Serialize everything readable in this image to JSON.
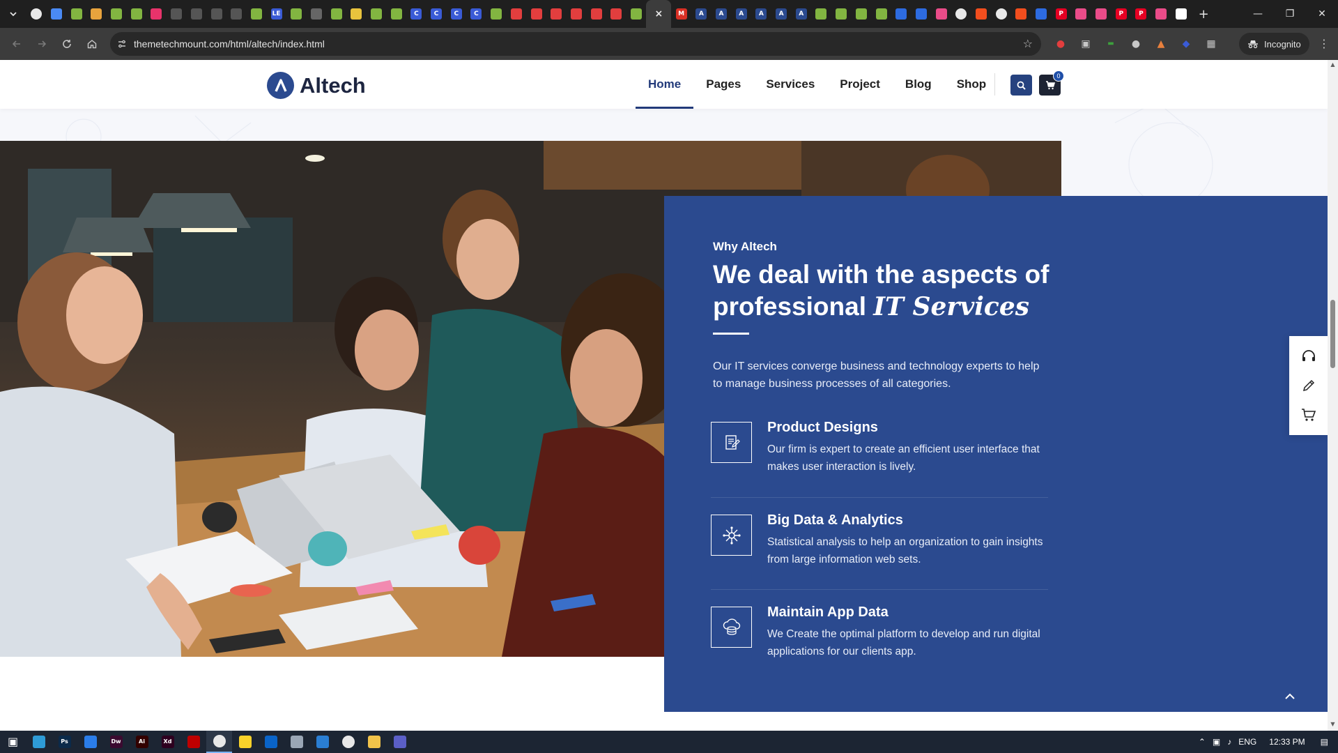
{
  "browser": {
    "tab_favicons": [
      {
        "icon": "chrome-icon",
        "color": "#e8e8e8",
        "glyph": ""
      },
      {
        "icon": "docs-icon",
        "color": "#4a8af4",
        "glyph": ""
      },
      {
        "icon": "envato-icon",
        "color": "#82b541",
        "glyph": ""
      },
      {
        "icon": "html-icon",
        "color": "#e8a33d",
        "glyph": ""
      },
      {
        "icon": "envato-icon",
        "color": "#82b541",
        "glyph": ""
      },
      {
        "icon": "envato-icon",
        "color": "#82b541",
        "glyph": ""
      },
      {
        "icon": "record-icon",
        "color": "#e8336b",
        "glyph": ""
      },
      {
        "icon": "github-icon",
        "color": "#555555",
        "glyph": ""
      },
      {
        "icon": "github-icon",
        "color": "#555555",
        "glyph": ""
      },
      {
        "icon": "github-icon",
        "color": "#555555",
        "glyph": ""
      },
      {
        "icon": "github-icon",
        "color": "#555555",
        "glyph": ""
      },
      {
        "icon": "envato-icon",
        "color": "#82b541",
        "glyph": ""
      },
      {
        "icon": "le-icon",
        "color": "#3a5bd6",
        "glyph": "LE"
      },
      {
        "icon": "envato-icon",
        "color": "#82b541",
        "glyph": ""
      },
      {
        "icon": "globe-icon",
        "color": "#666666",
        "glyph": ""
      },
      {
        "icon": "envato-icon",
        "color": "#82b541",
        "glyph": ""
      },
      {
        "icon": "tool-icon",
        "color": "#e8c33d",
        "glyph": ""
      },
      {
        "icon": "envato-icon",
        "color": "#82b541",
        "glyph": ""
      },
      {
        "icon": "envato-icon",
        "color": "#82b541",
        "glyph": ""
      },
      {
        "icon": "c-icon",
        "color": "#3a5bd6",
        "glyph": "C"
      },
      {
        "icon": "c-icon",
        "color": "#3a5bd6",
        "glyph": "C"
      },
      {
        "icon": "c-icon",
        "color": "#3a5bd6",
        "glyph": "C"
      },
      {
        "icon": "c-icon",
        "color": "#3a5bd6",
        "glyph": "C"
      },
      {
        "icon": "envato-icon",
        "color": "#82b541",
        "glyph": ""
      },
      {
        "icon": "red-circle-icon",
        "color": "#e23e3e",
        "glyph": ""
      },
      {
        "icon": "red-circle-icon",
        "color": "#e23e3e",
        "glyph": ""
      },
      {
        "icon": "red-circle-icon",
        "color": "#e23e3e",
        "glyph": ""
      },
      {
        "icon": "red-circle-icon",
        "color": "#e23e3e",
        "glyph": ""
      },
      {
        "icon": "red-circle-icon",
        "color": "#e23e3e",
        "glyph": ""
      },
      {
        "icon": "red-circle-icon",
        "color": "#e23e3e",
        "glyph": ""
      },
      {
        "icon": "envato-icon",
        "color": "#82b541",
        "glyph": ""
      }
    ],
    "active_tab_close": "×",
    "tab_favicons_after": [
      {
        "icon": "gmail-icon",
        "color": "#d93025",
        "glyph": "M"
      },
      {
        "icon": "altech-icon",
        "color": "#2b4a8f",
        "glyph": "A"
      },
      {
        "icon": "altech-icon",
        "color": "#2b4a8f",
        "glyph": "A"
      },
      {
        "icon": "altech-icon",
        "color": "#2b4a8f",
        "glyph": "A"
      },
      {
        "icon": "altech-icon",
        "color": "#2b4a8f",
        "glyph": "A"
      },
      {
        "icon": "altech-icon",
        "color": "#2b4a8f",
        "glyph": "A"
      },
      {
        "icon": "altech-icon",
        "color": "#2b4a8f",
        "glyph": "A"
      },
      {
        "icon": "envato-icon",
        "color": "#82b541",
        "glyph": ""
      },
      {
        "icon": "envato-icon",
        "color": "#82b541",
        "glyph": ""
      },
      {
        "icon": "envato-icon",
        "color": "#82b541",
        "glyph": ""
      },
      {
        "icon": "envato-icon",
        "color": "#82b541",
        "glyph": ""
      },
      {
        "icon": "blue-square-icon",
        "color": "#2d6be0",
        "glyph": ""
      },
      {
        "icon": "blue-square-icon",
        "color": "#2d6be0",
        "glyph": ""
      },
      {
        "icon": "dribbble-icon",
        "color": "#ea4c89",
        "glyph": ""
      },
      {
        "icon": "chrome-icon",
        "color": "#e8e8e8",
        "glyph": ""
      },
      {
        "icon": "figma-icon",
        "color": "#f24e1e",
        "glyph": ""
      },
      {
        "icon": "chrome-icon",
        "color": "#e8e8e8",
        "glyph": ""
      },
      {
        "icon": "figma-icon",
        "color": "#f24e1e",
        "glyph": ""
      },
      {
        "icon": "blue-square-icon",
        "color": "#2d6be0",
        "glyph": ""
      },
      {
        "icon": "pinterest-icon",
        "color": "#e60023",
        "glyph": "P"
      },
      {
        "icon": "dribbble-icon",
        "color": "#ea4c89",
        "glyph": ""
      },
      {
        "icon": "dribbble-icon",
        "color": "#ea4c89",
        "glyph": ""
      },
      {
        "icon": "pinterest-icon",
        "color": "#e60023",
        "glyph": "P"
      },
      {
        "icon": "pinterest-icon",
        "color": "#e60023",
        "glyph": "P"
      },
      {
        "icon": "dribbble-icon",
        "color": "#ea4c89",
        "glyph": ""
      },
      {
        "icon": "notion-icon",
        "color": "#ffffff",
        "glyph": ""
      }
    ],
    "new_tab": "+",
    "url": "themetechmount.com/html/altech/index.html",
    "profile_label": "Incognito"
  },
  "site": {
    "logo_text": "Altech",
    "logo_mark": "A",
    "nav": [
      "Home",
      "Pages",
      "Services",
      "Project",
      "Blog",
      "Shop"
    ],
    "nav_active": "Home",
    "cart_count": "0",
    "accent": "#2b4a8f"
  },
  "section": {
    "eyebrow": "Why Altech",
    "headline_1": "We deal with the aspects of professional",
    "headline_2": "IT Services",
    "intro": "Our IT services converge business and technology experts to help to manage business processes of all categories.",
    "features": [
      {
        "title": "Product Designs",
        "description": "Our firm is expert to create an efficient user interface that makes user interaction is lively.",
        "icon": "design-document-icon"
      },
      {
        "title": "Big Data & Analytics",
        "description": "Statistical analysis to help an organization to gain insights from large information web sets.",
        "icon": "network-hub-icon"
      },
      {
        "title": "Maintain App Data",
        "description": "We Create the optimal platform to develop and run digital applications for our clients app.",
        "icon": "cloud-database-icon"
      }
    ]
  },
  "taskbar": {
    "apps": [
      {
        "icon": "windows-start-icon",
        "color": "#ffffff",
        "glyph": ""
      },
      {
        "icon": "edge-icon",
        "color": "#2e9bd6",
        "glyph": ""
      },
      {
        "icon": "photoshop-icon",
        "color": "#0b2a4a",
        "glyph": "Ps"
      },
      {
        "icon": "todo-icon",
        "color": "#2b7de9",
        "glyph": ""
      },
      {
        "icon": "dreamweaver-icon",
        "color": "#3b0a30",
        "glyph": "Dw"
      },
      {
        "icon": "illustrator-icon",
        "color": "#330000",
        "glyph": "Ai"
      },
      {
        "icon": "xd-icon",
        "color": "#2e001f",
        "glyph": "Xd"
      },
      {
        "icon": "filezilla-icon",
        "color": "#bf0000",
        "glyph": ""
      },
      {
        "icon": "chrome-icon",
        "color": "#e8e8e8",
        "glyph": ""
      },
      {
        "icon": "sticky-notes-icon",
        "color": "#f9d22a",
        "glyph": ""
      },
      {
        "icon": "outlook-icon",
        "color": "#0a64c8",
        "glyph": ""
      },
      {
        "icon": "notepad-icon",
        "color": "#9aa6b5",
        "glyph": ""
      },
      {
        "icon": "vscode-icon",
        "color": "#2a7ed3",
        "glyph": ""
      },
      {
        "icon": "chrome-icon",
        "color": "#e8e8e8",
        "glyph": ""
      },
      {
        "icon": "file-explorer-icon",
        "color": "#f2c34a",
        "glyph": ""
      },
      {
        "icon": "teams-icon",
        "color": "#5b5fc7",
        "glyph": ""
      }
    ],
    "language": "ENG",
    "time": "12:33 PM"
  }
}
